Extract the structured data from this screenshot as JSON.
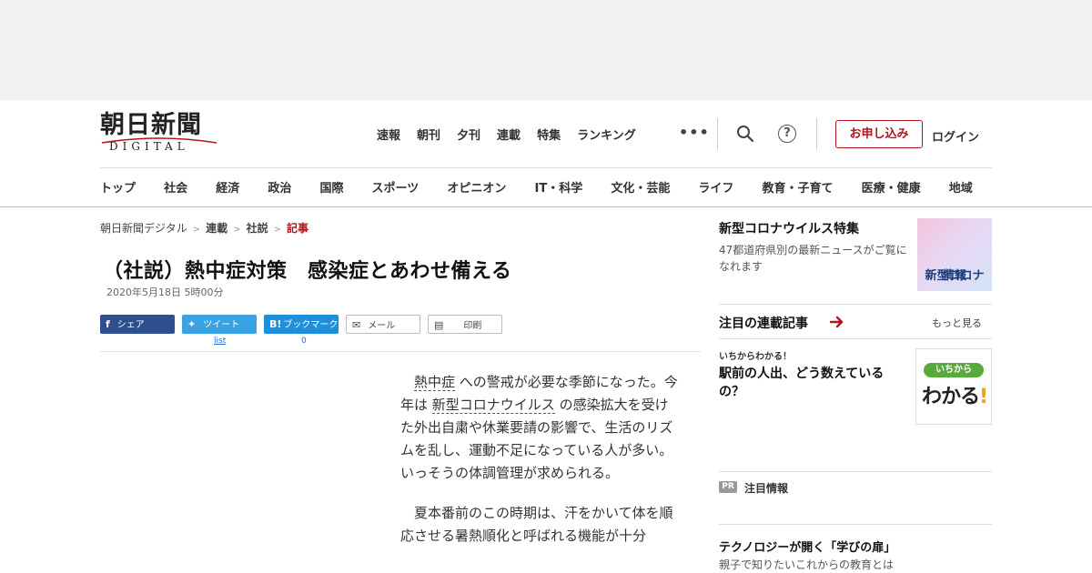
{
  "logo": {
    "main": "朝日新聞",
    "sub": "DIGITAL"
  },
  "top_nav": [
    "速報",
    "朝刊",
    "夕刊",
    "連載",
    "特集",
    "ランキング"
  ],
  "header": {
    "more": "•••",
    "apply_label": "お申し込み",
    "login_label": "ログイン"
  },
  "categories": [
    "トップ",
    "社会",
    "経済",
    "政治",
    "国際",
    "スポーツ",
    "オピニオン",
    "IT・科学",
    "文化・芸能",
    "ライフ",
    "教育・子育て",
    "医療・健康",
    "地域"
  ],
  "breadcrumb": [
    "朝日新聞デジタル",
    "連載",
    "社説",
    "記事"
  ],
  "article": {
    "title": "（社説）熱中症対策　感染症とあわせ備える",
    "date": "2020年5月18日 5時00分",
    "p1_kw1": "熱中症",
    "p1_a": " への警戒が必要な季節になった。今年は ",
    "p1_kw2": "新型コロナウイルス",
    "p1_b": " の感染拡大を受けた外出自粛や休業要請の影響で、生活のリズムを乱し、運動不足になっている人が多い。いっそうの体調管理が求められる。",
    "p2": "夏本番前のこの時期は、汗をかいて体を順応させる暑熱順化と呼ばれる機能が十分"
  },
  "share": {
    "facebook": "シェア",
    "twitter": "ツイート",
    "hatena": "ブックマーク",
    "mail": "メール",
    "print": "印刷",
    "twitter_count": "list",
    "hatena_count": "0"
  },
  "sidebar": {
    "corona": {
      "title": "新型コロナウイルス特集",
      "desc": "47都道府県別の最新ニュースがご覧になれます",
      "thumb_line1": "新型コロナ",
      "thumb_line2": "情報"
    },
    "serial": {
      "heading": "注目の連載記事",
      "more": "もっと見る",
      "kicker": "いちからわかる！",
      "title": "駅前の人出、どう数えているの？",
      "thumb_top": "いちから",
      "thumb_main": "わかる",
      "thumb_excl": "!"
    },
    "pr": {
      "badge": "PR",
      "label": "注目情報",
      "title": "テクノロジーが開く「学びの扉」",
      "sub": "親子で知りたいこれからの教育とは"
    }
  },
  "colors": {
    "accent_red": "#b0141c",
    "facebook": "#2d4f8b",
    "twitter": "#3aa1e3",
    "hatena": "#1f8fdb"
  }
}
